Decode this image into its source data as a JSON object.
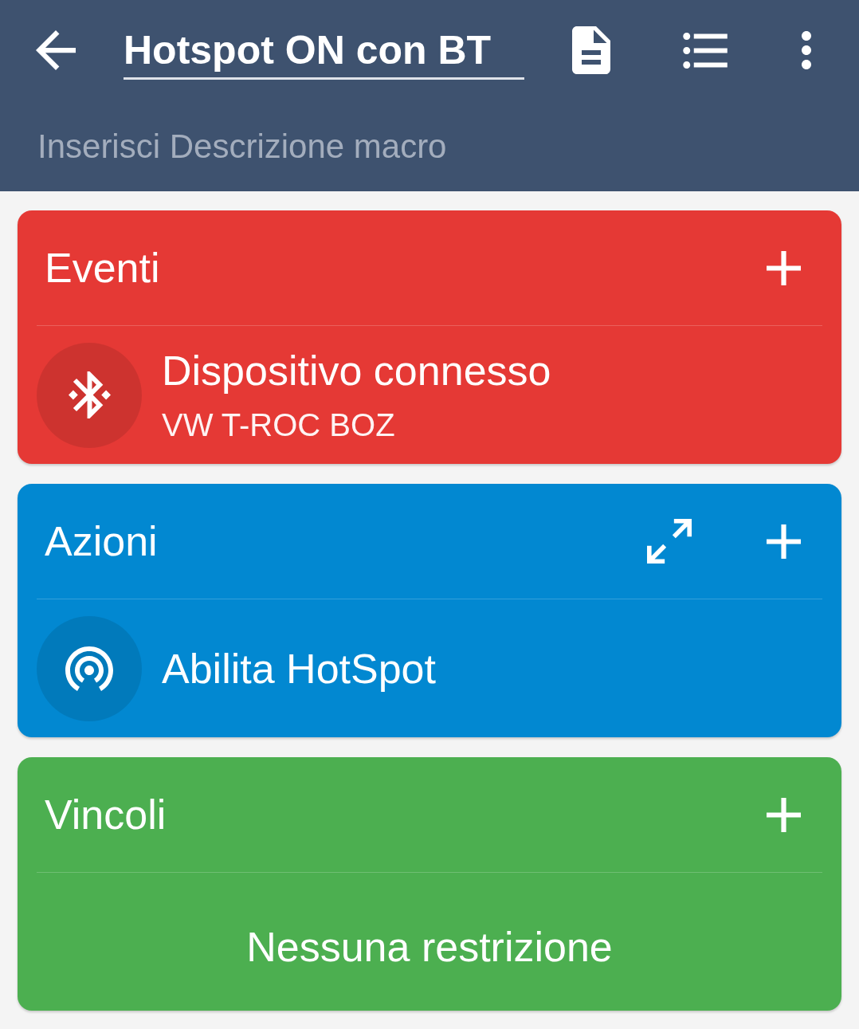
{
  "toolbar": {
    "title": "Hotspot ON con BT"
  },
  "description": {
    "placeholder": "Inserisci Descrizione macro"
  },
  "sections": [
    {
      "title": "Eventi",
      "color": "#e53935",
      "expand_button": false,
      "items": [
        {
          "kind": "bluetooth",
          "title": "Dispositivo connesso",
          "detail": "VW T-ROC BOZ"
        }
      ]
    },
    {
      "title": "Azioni",
      "color": "#0288d1",
      "expand_button": true,
      "items": [
        {
          "kind": "hotspot",
          "title": "Abilita HotSpot"
        }
      ]
    },
    {
      "title": "Vincoli",
      "color": "#4caf50",
      "expand_button": false,
      "empty_text": "Nessuna restrizione"
    }
  ]
}
